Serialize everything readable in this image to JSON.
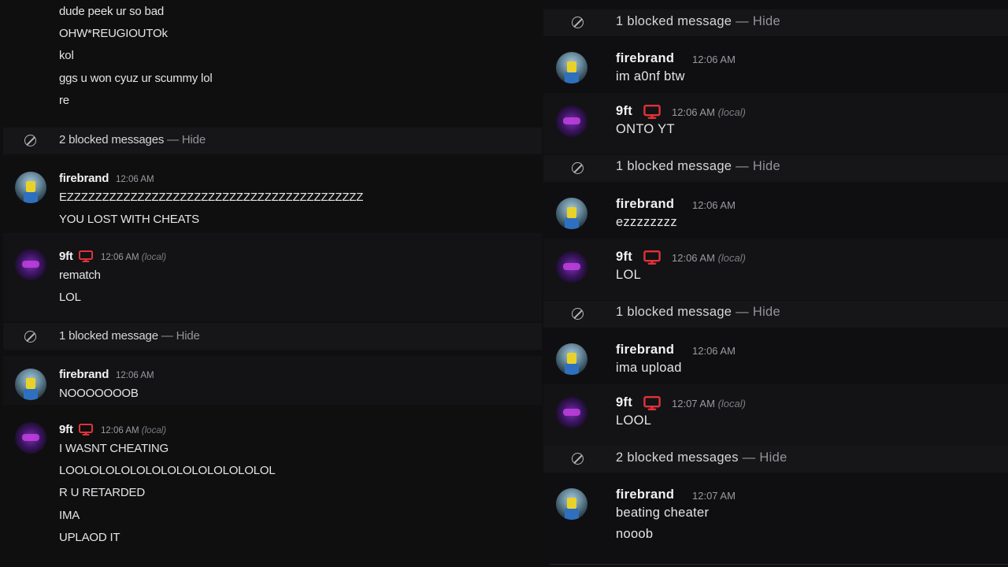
{
  "labels": {
    "hide": "Hide",
    "dash": " — ",
    "local": "(local)"
  },
  "users": {
    "firebrand": "firebrand",
    "nineft": "9ft"
  },
  "left": {
    "top_lines": [
      "dude peek ur so bad",
      "OHW*REUGIOUTOk",
      "kol",
      "ggs u won cyuz ur scummy lol",
      "re"
    ],
    "blocked_1": "2 blocked messages",
    "group_1": {
      "time": "12:06 AM",
      "lines": [
        "EZZZZZZZZZZZZZZZZZZZZZZZZZZZZZZZZZZZZZZZZZZ",
        "YOU LOST WITH CHEATS"
      ]
    },
    "group_2": {
      "time": "12:06 AM",
      "lines": [
        "rematch",
        "LOL"
      ]
    },
    "blocked_2": "1 blocked message",
    "group_3": {
      "time": "12:06 AM",
      "lines": [
        "NOOOOOOOB"
      ]
    },
    "group_4": {
      "time": "12:06 AM",
      "lines": [
        "I WASNT CHEATING",
        "LOOLOLOLOLOLOLOLOLOLOLOLOLOL",
        "R U RETARDED",
        "IMA",
        "UPLAOD IT"
      ]
    }
  },
  "right": {
    "blocked_1": "1 blocked message",
    "group_1": {
      "time": "12:06 AM",
      "lines": [
        "im a0nf btw"
      ]
    },
    "group_2": {
      "time": "12:06 AM",
      "lines": [
        "ONTO YT"
      ]
    },
    "blocked_2": "1 blocked message",
    "group_3": {
      "time": "12:06 AM",
      "lines": [
        "ezzzzzzzz"
      ]
    },
    "group_4": {
      "time": "12:06 AM",
      "lines": [
        "LOL"
      ]
    },
    "blocked_3": "1 blocked message",
    "group_5": {
      "time": "12:06 AM",
      "lines": [
        "ima upload"
      ]
    },
    "group_6": {
      "time": "12:07 AM",
      "lines": [
        "LOOL"
      ]
    },
    "blocked_4": "2 blocked messages",
    "group_7": {
      "time": "12:07 AM",
      "lines": [
        "beating cheater",
        "nooob"
      ]
    }
  },
  "colors": {
    "background": "#0f0f10",
    "blocked_row": "#161618",
    "monitor_icon": "#e0323a",
    "muted_text": "#949499"
  },
  "icons": {
    "blocked": "blocked-icon",
    "monitor": "monitor-icon"
  }
}
